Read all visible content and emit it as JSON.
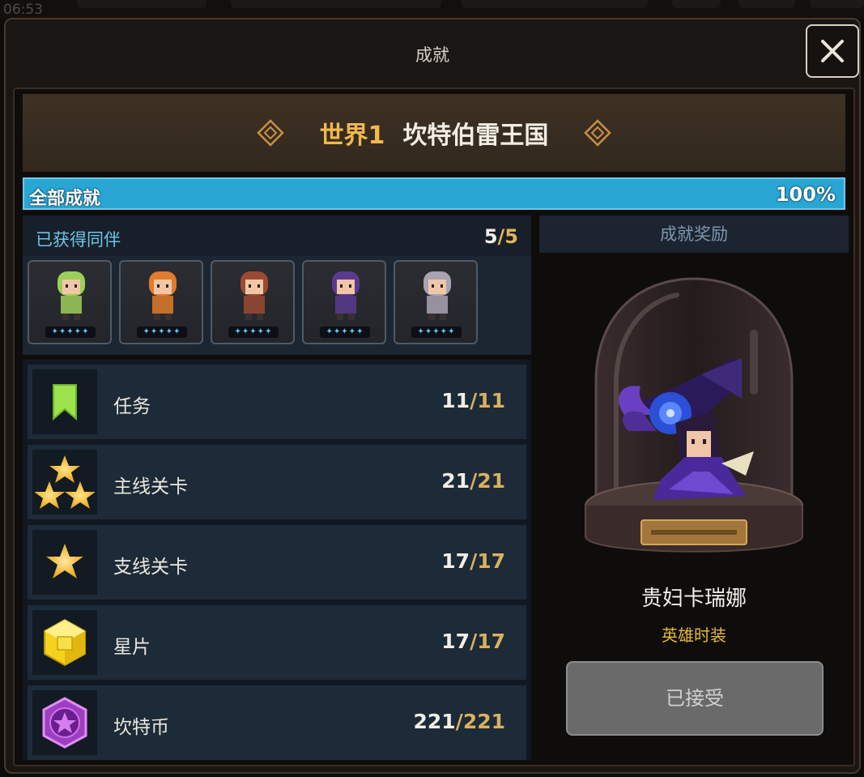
{
  "status_bar": {
    "time": "06:53"
  },
  "dialog": {
    "title": "成就"
  },
  "world": {
    "number_label": "世界1",
    "name": "坎特伯雷王国"
  },
  "overall": {
    "label": "全部成就",
    "percent_text": "100%",
    "percent": 100
  },
  "companions": {
    "title": "已获得同伴",
    "obtained": "5",
    "separator": "/",
    "total": "5",
    "items": [
      {
        "name": "companion-green",
        "color": "#9ccf5a"
      },
      {
        "name": "companion-apple",
        "color": "#e27b2b"
      },
      {
        "name": "companion-brown",
        "color": "#9c4a32"
      },
      {
        "name": "companion-purple",
        "color": "#5b3a8f"
      },
      {
        "name": "companion-wolf",
        "color": "#a9a3b3"
      }
    ]
  },
  "achievements": [
    {
      "icon": "bookmark-icon",
      "name": "任务",
      "done": "11",
      "total": "11"
    },
    {
      "icon": "three-stars-icon",
      "name": "主线关卡",
      "done": "21",
      "total": "21"
    },
    {
      "icon": "star-icon",
      "name": "支线关卡",
      "done": "17",
      "total": "17"
    },
    {
      "icon": "star-piece-cube-icon",
      "name": "星片",
      "done": "17",
      "total": "17"
    },
    {
      "icon": "kanterbury-coin-icon",
      "name": "坎特币",
      "done": "221",
      "total": "221"
    }
  ],
  "reward": {
    "header": "成就奖励",
    "item_name": "贵妇卡瑞娜",
    "item_type": "英雄时装",
    "button_label": "已接受"
  },
  "colors": {
    "accent_gold": "#e2b45a",
    "progress_blue": "#2aa6d4",
    "companion_label_blue": "#6fc4e8"
  }
}
